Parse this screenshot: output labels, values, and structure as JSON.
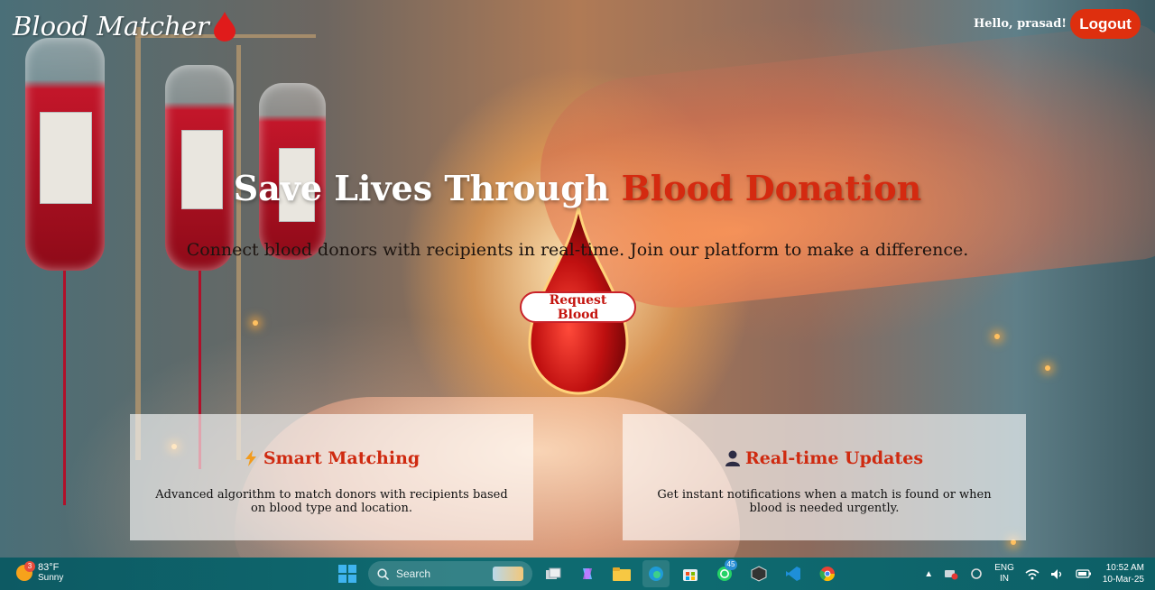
{
  "header": {
    "logo_text": "Blood Matcher",
    "greeting": "Hello, prasad!",
    "logout_label": "Logout"
  },
  "hero": {
    "title_main": "Save Lives Through ",
    "title_accent": "Blood Donation",
    "subtitle": "Connect blood donors with recipients in real-time. Join our platform to make a difference.",
    "cta_label": "Request Blood"
  },
  "features": [
    {
      "icon": "lightning-icon",
      "title": "Smart Matching",
      "text": "Advanced algorithm to match donors with recipients based on blood type and location."
    },
    {
      "icon": "user-icon",
      "title": "Real-time Updates",
      "text": "Get instant notifications when a match is found or when blood is needed urgently."
    }
  ],
  "colors": {
    "accent": "#d42a10",
    "logout_bg": "#de2f0e",
    "taskbar": "#0e6a70"
  },
  "taskbar": {
    "weather": {
      "temp": "83°F",
      "condition": "Sunny",
      "badge": "3"
    },
    "search_label": "Search",
    "whatsapp_badge": "45",
    "lang_top": "ENG",
    "lang_bottom": "IN",
    "time": "10:52 AM",
    "date": "10-Mar-25"
  }
}
